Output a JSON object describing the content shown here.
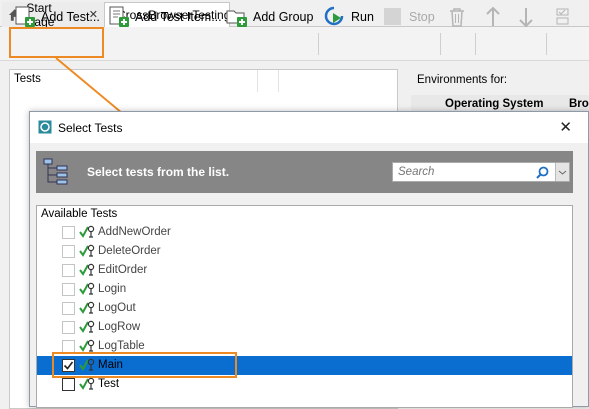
{
  "tabs": [
    {
      "label": "Start Page",
      "close": "✕"
    },
    {
      "label": "CrossBrowserTesting"
    }
  ],
  "toolbar": {
    "add_test": "Add Test...",
    "add_test_items": "Add Test Item...",
    "add_group": "Add Group",
    "run": "Run",
    "stop": "Stop"
  },
  "left_panel": {
    "header": "Tests"
  },
  "right_panel": {
    "environments_label": "Environments for:",
    "col_os": "Operating System",
    "col_browser": "Bro"
  },
  "dialog": {
    "title": "Select Tests",
    "close": "✕",
    "banner_text": "Select tests from the list.",
    "search_placeholder": "Search",
    "list_header": "Available Tests",
    "tests": [
      {
        "name": "AddNewOrder",
        "checked": false
      },
      {
        "name": "DeleteOrder",
        "checked": false
      },
      {
        "name": "EditOrder",
        "checked": false
      },
      {
        "name": "Login",
        "checked": false
      },
      {
        "name": "LogOut",
        "checked": false
      },
      {
        "name": "LogRow",
        "checked": false
      },
      {
        "name": "LogTable",
        "checked": false
      },
      {
        "name": "Main",
        "checked": true,
        "selected": true
      },
      {
        "name": "Test",
        "checked": false
      }
    ]
  },
  "colors": {
    "accent": "#0a6ed1",
    "highlight": "#ee8a23",
    "banner": "#868686"
  }
}
